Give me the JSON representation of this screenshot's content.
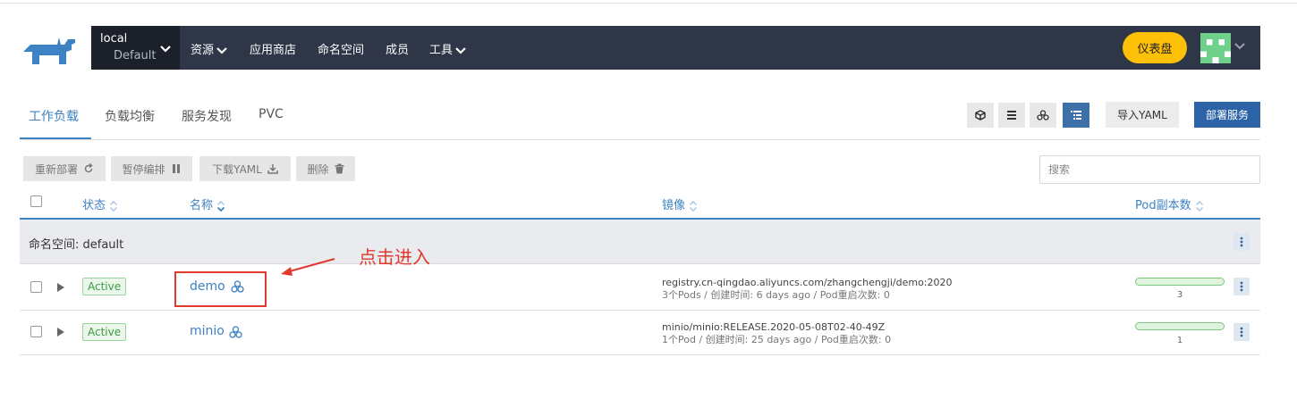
{
  "header": {
    "cluster_name": "local",
    "project_name": "Default",
    "nav": [
      {
        "label": "资源",
        "has_dropdown": true
      },
      {
        "label": "应用商店",
        "has_dropdown": false
      },
      {
        "label": "命名空间",
        "has_dropdown": false
      },
      {
        "label": "成员",
        "has_dropdown": false
      },
      {
        "label": "工具",
        "has_dropdown": true
      }
    ],
    "dashboard_label": "仪表盘"
  },
  "tabs": [
    "工作负载",
    "负载均衡",
    "服务发现",
    "PVC"
  ],
  "active_tab": "工作负载",
  "toolbar": {
    "view_icons": [
      "cube-icon",
      "list-icon",
      "group-icon",
      "tree-list-icon"
    ],
    "import_yaml": "导入YAML",
    "deploy": "部署服务"
  },
  "bulk_actions": {
    "redeploy": "重新部署",
    "pause": "暂停编排",
    "download_yaml": "下载YAML",
    "delete": "删除"
  },
  "search": {
    "placeholder": "搜索",
    "value": ""
  },
  "table": {
    "headers": {
      "state": "状态",
      "name": "名称",
      "image": "镜像",
      "pods": "Pod副本数"
    },
    "group": {
      "label": "命名空间: default"
    },
    "rows": [
      {
        "state": "Active",
        "name": "demo",
        "image": "registry.cn-qingdao.aliyuncs.com/zhangchengji/demo:2020",
        "details": "3个Pods / 创建时间: 6 days ago / Pod重启次数: 0",
        "pod_count": "3",
        "pods_ready_fraction": 1.0
      },
      {
        "state": "Active",
        "name": "minio",
        "image": "minio/minio:RELEASE.2020-05-08T02-40-49Z",
        "details": "1个Pod / 创建时间: 25 days ago / Pod重启次数: 0",
        "pod_count": "1",
        "pods_ready_fraction": 1.0
      }
    ]
  },
  "annotation": {
    "text": "点击进入"
  },
  "colors": {
    "navbar": "#2e3647",
    "accent": "#3d82c2",
    "primary_button": "#2c63a6",
    "dashboard_button": "#ffc107",
    "active_badge": "#3d9b42",
    "annotation": "#e03a2e"
  }
}
